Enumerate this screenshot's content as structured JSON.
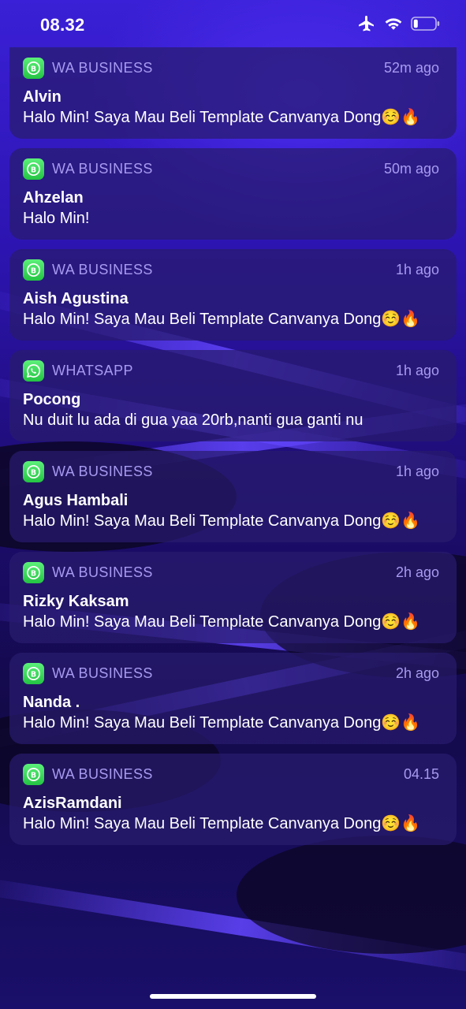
{
  "status_bar": {
    "time": "08.32",
    "icons": [
      "airplane-icon",
      "wifi-icon",
      "battery-icon"
    ]
  },
  "notifications": [
    {
      "app": "WA BUSINESS",
      "app_icon": "whatsapp-business-icon",
      "time": "52m ago",
      "sender": "Alvin",
      "message": "Halo Min! Saya Mau Beli Template Canvanya Dong☺️🔥"
    },
    {
      "app": "WA BUSINESS",
      "app_icon": "whatsapp-business-icon",
      "time": "50m ago",
      "sender": "Ahzelan",
      "message": "Halo Min!"
    },
    {
      "app": "WA BUSINESS",
      "app_icon": "whatsapp-business-icon",
      "time": "1h ago",
      "sender": "Aish Agustina",
      "message": "Halo Min! Saya Mau Beli Template Canvanya Dong☺️🔥"
    },
    {
      "app": "WHATSAPP",
      "app_icon": "whatsapp-icon",
      "time": "1h ago",
      "sender": "Pocong",
      "message": "Nu duit lu ada di gua yaa 20rb,nanti gua ganti nu"
    },
    {
      "app": "WA BUSINESS",
      "app_icon": "whatsapp-business-icon",
      "time": "1h ago",
      "sender": "Agus Hambali",
      "message": "Halo Min! Saya Mau Beli Template Canvanya Dong☺️🔥"
    },
    {
      "app": "WA BUSINESS",
      "app_icon": "whatsapp-business-icon",
      "time": "2h ago",
      "sender": "Rizky Kaksam",
      "message": "Halo Min! Saya Mau Beli Template Canvanya Dong☺️🔥"
    },
    {
      "app": "WA BUSINESS",
      "app_icon": "whatsapp-business-icon",
      "time": "2h ago",
      "sender": "Nanda .",
      "message": "Halo Min! Saya Mau Beli Template Canvanya Dong☺️🔥"
    },
    {
      "app": "WA BUSINESS",
      "app_icon": "whatsapp-business-icon",
      "time": "04.15",
      "sender": "AzisRamdani",
      "message": "Halo Min! Saya Mau Beli Template Canvanya Dong☺️🔥"
    }
  ],
  "colors": {
    "accent_text": "#a79af0",
    "card_bg": "#281c6e",
    "whatsapp_green": "#25c444"
  }
}
